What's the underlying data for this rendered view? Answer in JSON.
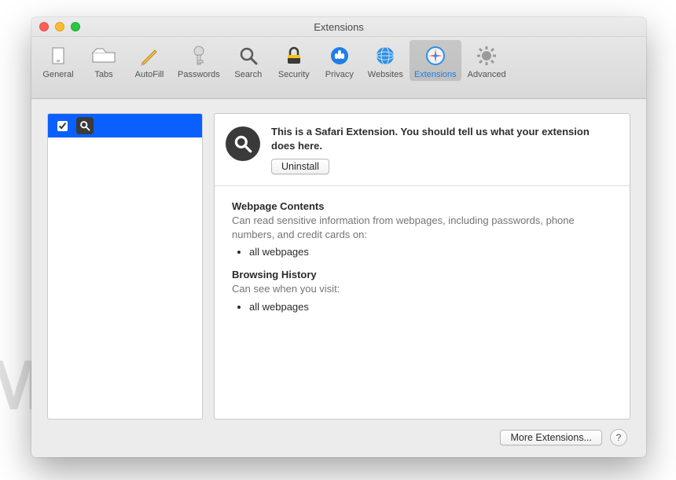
{
  "window": {
    "title": "Extensions"
  },
  "toolbar": {
    "items": [
      {
        "label": "General"
      },
      {
        "label": "Tabs"
      },
      {
        "label": "AutoFill"
      },
      {
        "label": "Passwords"
      },
      {
        "label": "Search"
      },
      {
        "label": "Security"
      },
      {
        "label": "Privacy"
      },
      {
        "label": "Websites"
      },
      {
        "label": "Extensions"
      },
      {
        "label": "Advanced"
      }
    ]
  },
  "sidebar": {
    "selected": {
      "checked": true
    }
  },
  "detail": {
    "summary": "This is a Safari Extension. You should tell us what your extension does here.",
    "uninstall_label": "Uninstall",
    "sections": [
      {
        "title": "Webpage Contents",
        "desc": "Can read sensitive information from webpages, including passwords, phone numbers, and credit cards on:",
        "items": [
          "all webpages"
        ]
      },
      {
        "title": "Browsing History",
        "desc": "Can see when you visit:",
        "items": [
          "all webpages"
        ]
      }
    ]
  },
  "footer": {
    "more_label": "More Extensions...",
    "help_label": "?"
  },
  "watermark": "MALWARETIPS"
}
